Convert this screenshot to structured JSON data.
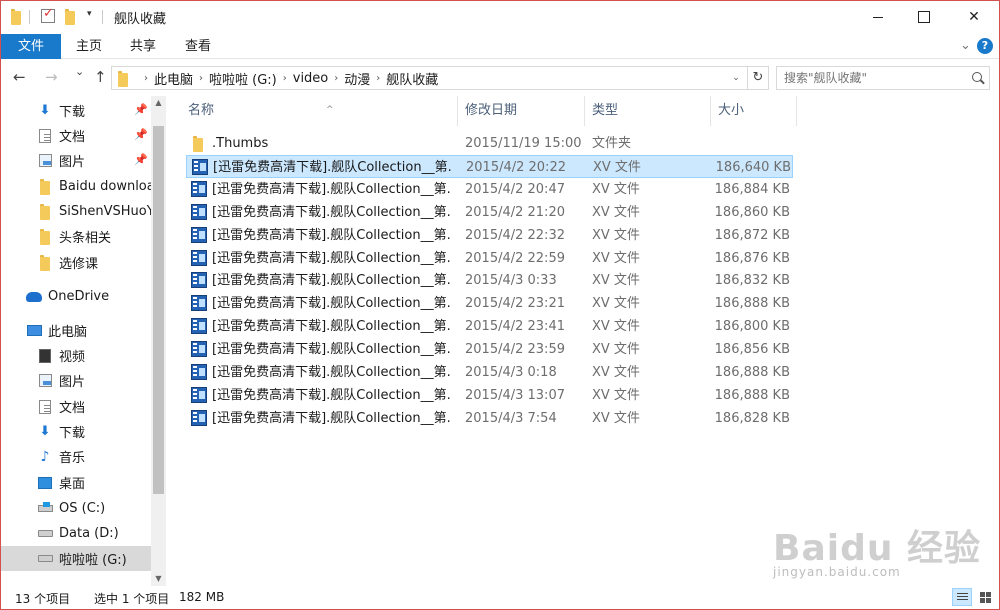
{
  "window": {
    "title": "舰队收藏",
    "controls": {
      "minimize": "",
      "maximize": "",
      "close": "✕"
    }
  },
  "ribbon": {
    "tabs": [
      "文件",
      "主页",
      "共享",
      "查看"
    ],
    "expand_icon": "chevron-down",
    "help_label": "?"
  },
  "nav": {
    "back": "←",
    "forward": "→",
    "recent": "⌄",
    "up": "↑",
    "breadcrumbs": [
      "此电脑",
      "啦啦啦 (G:)",
      "video",
      "动漫",
      "舰队收藏"
    ],
    "refresh": "↻",
    "search_placeholder": "搜索\"舰队收藏\""
  },
  "sidebar": {
    "quick_access": [
      {
        "label": "下载",
        "icon": "download-icon",
        "pinned": true
      },
      {
        "label": "文档",
        "icon": "document-icon",
        "pinned": true
      },
      {
        "label": "图片",
        "icon": "picture-icon",
        "pinned": true
      },
      {
        "label": "Baidu download",
        "icon": "folder-icon",
        "pinned": false
      },
      {
        "label": "SiShenVSHuoY",
        "icon": "folder-icon",
        "pinned": false
      },
      {
        "label": "头条相关",
        "icon": "folder-icon",
        "pinned": false
      },
      {
        "label": "选修课",
        "icon": "folder-icon",
        "pinned": false
      }
    ],
    "onedrive": "OneDrive",
    "this_pc": "此电脑",
    "pc_items": [
      {
        "label": "视频",
        "icon": "video-icon"
      },
      {
        "label": "图片",
        "icon": "picture-icon"
      },
      {
        "label": "文档",
        "icon": "document-icon"
      },
      {
        "label": "下载",
        "icon": "download-icon"
      },
      {
        "label": "音乐",
        "icon": "music-icon"
      },
      {
        "label": "桌面",
        "icon": "desktop-icon"
      },
      {
        "label": "OS (C:)",
        "icon": "os-drive-icon"
      },
      {
        "label": "Data (D:)",
        "icon": "drive-icon"
      },
      {
        "label": "啦啦啦 (G:)",
        "icon": "drive-icon",
        "selected": true
      }
    ],
    "pin_glyph": "📌"
  },
  "list": {
    "columns": {
      "name": "名称",
      "date": "修改日期",
      "type": "类型",
      "size": "大小"
    },
    "sort_glyph": "^",
    "rows": [
      {
        "name": ".Thumbs",
        "date": "2015/11/19 15:00",
        "type": "文件夹",
        "size": "",
        "icon": "folder-icon"
      },
      {
        "name": "[迅雷免费高清下载].舰队Collection__第...",
        "date": "2015/4/2 20:22",
        "type": "XV 文件",
        "size": "186,640 KB",
        "icon": "xv-file-icon",
        "selected": true
      },
      {
        "name": "[迅雷免费高清下载].舰队Collection__第...",
        "date": "2015/4/2 20:47",
        "type": "XV 文件",
        "size": "186,884 KB",
        "icon": "xv-file-icon"
      },
      {
        "name": "[迅雷免费高清下载].舰队Collection__第...",
        "date": "2015/4/2 21:20",
        "type": "XV 文件",
        "size": "186,860 KB",
        "icon": "xv-file-icon"
      },
      {
        "name": "[迅雷免费高清下载].舰队Collection__第...",
        "date": "2015/4/2 22:32",
        "type": "XV 文件",
        "size": "186,872 KB",
        "icon": "xv-file-icon"
      },
      {
        "name": "[迅雷免费高清下载].舰队Collection__第...",
        "date": "2015/4/2 22:59",
        "type": "XV 文件",
        "size": "186,876 KB",
        "icon": "xv-file-icon"
      },
      {
        "name": "[迅雷免费高清下载].舰队Collection__第...",
        "date": "2015/4/3 0:33",
        "type": "XV 文件",
        "size": "186,832 KB",
        "icon": "xv-file-icon"
      },
      {
        "name": "[迅雷免费高清下载].舰队Collection__第...",
        "date": "2015/4/2 23:21",
        "type": "XV 文件",
        "size": "186,888 KB",
        "icon": "xv-file-icon"
      },
      {
        "name": "[迅雷免费高清下载].舰队Collection__第...",
        "date": "2015/4/2 23:41",
        "type": "XV 文件",
        "size": "186,800 KB",
        "icon": "xv-file-icon"
      },
      {
        "name": "[迅雷免费高清下载].舰队Collection__第...",
        "date": "2015/4/2 23:59",
        "type": "XV 文件",
        "size": "186,856 KB",
        "icon": "xv-file-icon"
      },
      {
        "name": "[迅雷免费高清下载].舰队Collection__第...",
        "date": "2015/4/3 0:18",
        "type": "XV 文件",
        "size": "186,888 KB",
        "icon": "xv-file-icon"
      },
      {
        "name": "[迅雷免费高清下载].舰队Collection__第...",
        "date": "2015/4/3 13:07",
        "type": "XV 文件",
        "size": "186,888 KB",
        "icon": "xv-file-icon"
      },
      {
        "name": "[迅雷免费高清下载].舰队Collection__第...",
        "date": "2015/4/3 7:54",
        "type": "XV 文件",
        "size": "186,828 KB",
        "icon": "xv-file-icon"
      }
    ]
  },
  "status": {
    "item_count": "13 个项目",
    "selection": "选中 1 个项目",
    "selection_size": "182 MB"
  },
  "watermark": {
    "brand": "Baidu 经验",
    "site": "jingyan.baidu.com"
  },
  "colors": {
    "accent": "#1979ca",
    "selection": "#cce8ff",
    "selection_border": "#99d1ff",
    "window_border": "#d4504f"
  }
}
